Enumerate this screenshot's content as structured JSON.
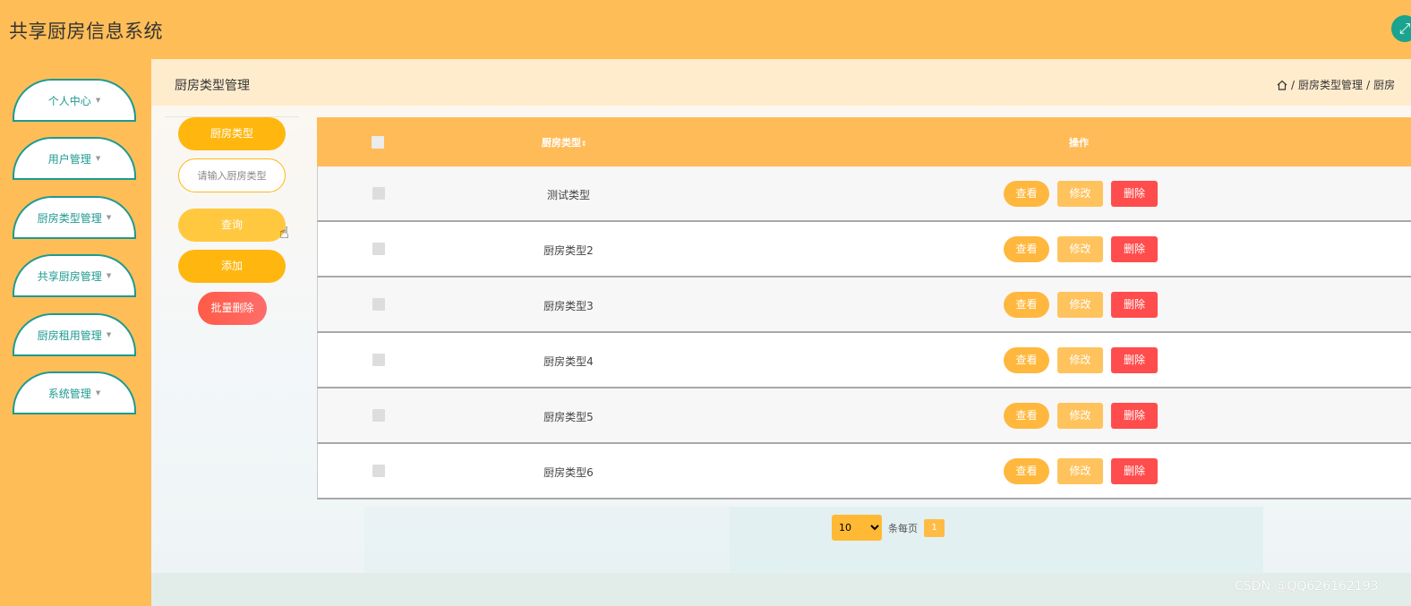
{
  "app": {
    "title": "共享厨房信息系统"
  },
  "sidebar": {
    "items": [
      {
        "label": "个人中心"
      },
      {
        "label": "用户管理"
      },
      {
        "label": "厨房类型管理"
      },
      {
        "label": "共享厨房管理"
      },
      {
        "label": "厨房租用管理"
      },
      {
        "label": "系统管理"
      }
    ]
  },
  "page": {
    "title": "厨房类型管理",
    "breadcrumb": {
      "sep": "/",
      "item1": "厨房类型管理",
      "item2": "厨房"
    }
  },
  "filters": {
    "label": "厨房类型",
    "input_placeholder": "请输入厨房类型",
    "query_label": "查询",
    "add_label": "添加",
    "batch_delete_label": "批量删除"
  },
  "table": {
    "col_name": "厨房类型",
    "col_ops": "操作",
    "rows": [
      {
        "name": "测试类型"
      },
      {
        "name": "厨房类型2"
      },
      {
        "name": "厨房类型3"
      },
      {
        "name": "厨房类型4"
      },
      {
        "name": "厨房类型5"
      },
      {
        "name": "厨房类型6"
      }
    ],
    "view_label": "查看",
    "edit_label": "修改",
    "delete_label": "删除"
  },
  "pagination": {
    "page_size": "10",
    "per_page_label": "条每页",
    "current_page": "1"
  },
  "watermark": "CSDN @QQ626162193",
  "colors": {
    "primary": "#ffbd57",
    "accent": "#ffb70f",
    "teal": "#1e9a90",
    "danger": "#ff4c4c"
  }
}
